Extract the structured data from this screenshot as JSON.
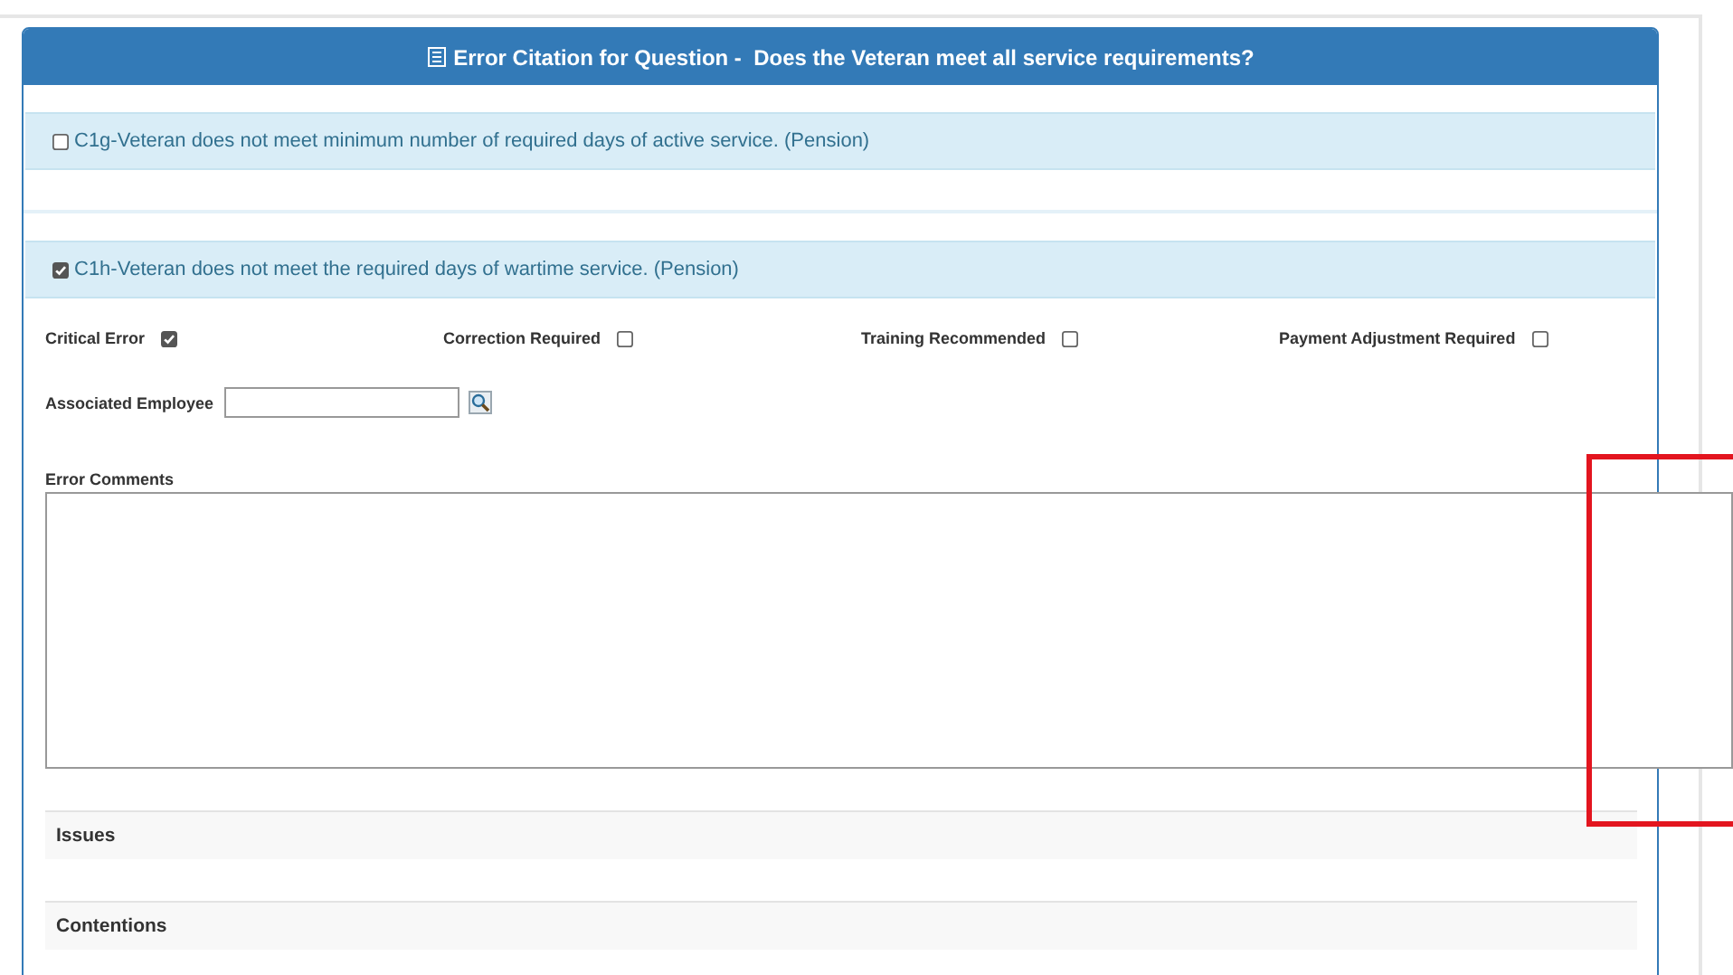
{
  "header": {
    "title": "Error Citation for Question -  Does the Veteran meet all service requirements?"
  },
  "errors": [
    {
      "label": "C1g-Veteran does not meet minimum number of required days of active service. (Pension)",
      "checked": false
    },
    {
      "label": "C1h-Veteran does not meet the required days of wartime service. (Pension)",
      "checked": true
    }
  ],
  "flags": [
    {
      "label": "Critical Error",
      "checked": true
    },
    {
      "label": "Correction Required",
      "checked": false
    },
    {
      "label": "Training Recommended",
      "checked": false
    },
    {
      "label": "Payment Adjustment Required",
      "checked": false
    }
  ],
  "employee_field": {
    "label": "Associated Employee"
  },
  "comments": {
    "label": "Error Comments"
  },
  "sections": [
    {
      "title": "Issues"
    },
    {
      "title": "Contentions"
    }
  ],
  "annotation": {
    "kind": "box"
  }
}
